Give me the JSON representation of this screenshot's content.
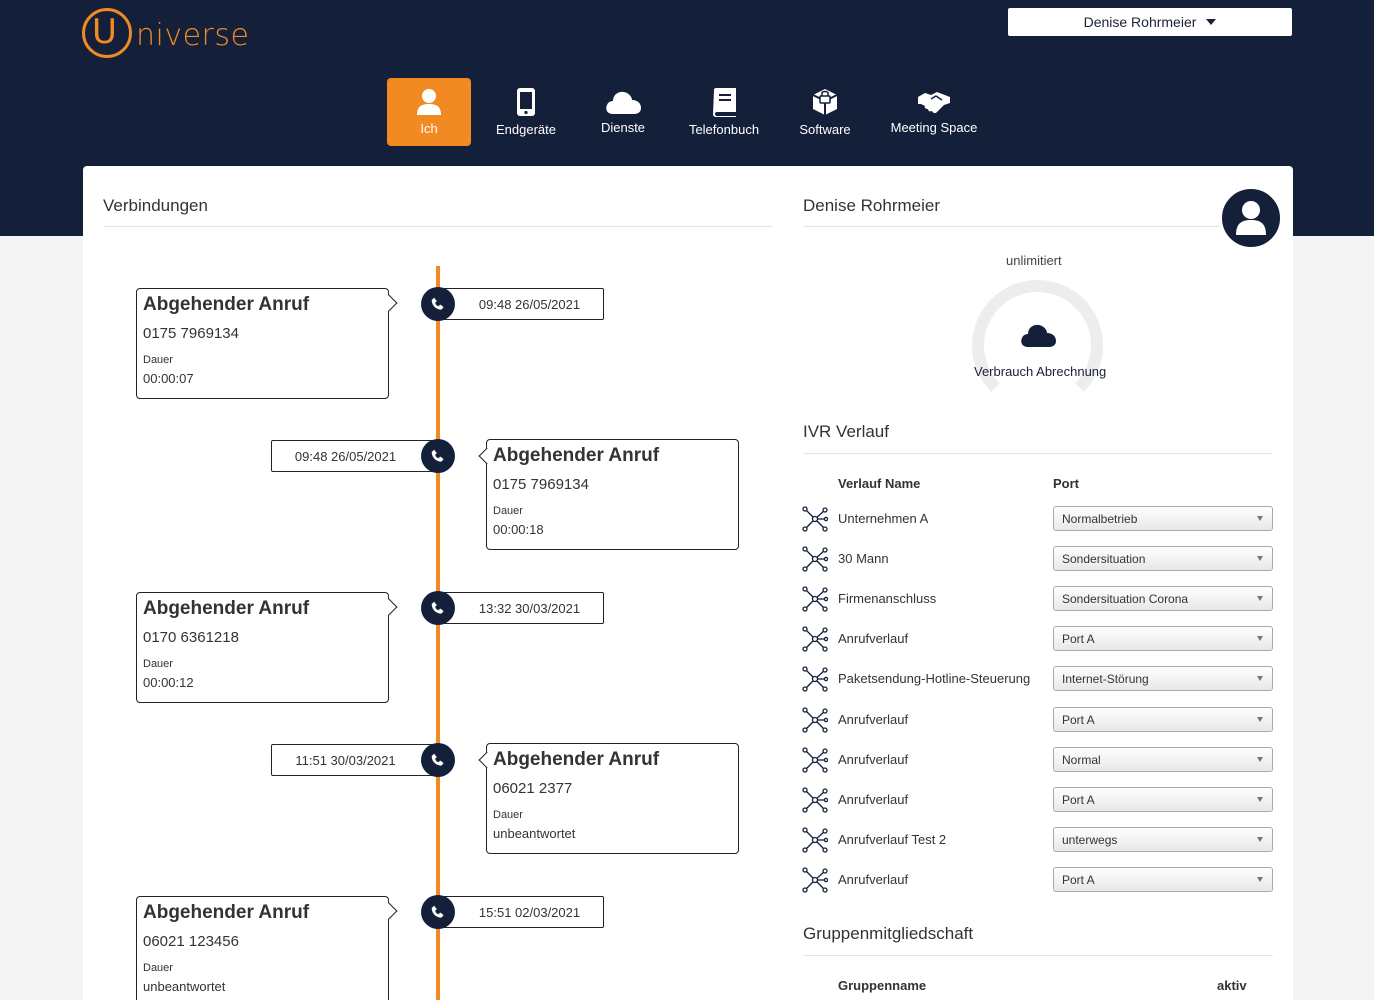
{
  "brand": {
    "logo_u": "U",
    "logo_rest": "niverse",
    "accent": "#f28a24",
    "navy": "#14203a"
  },
  "user_menu": {
    "name": "Denise Rohrmeier",
    "icon": "caret-down-icon"
  },
  "nav": [
    {
      "label": "Ich",
      "icon": "person-icon",
      "active": true
    },
    {
      "label": "Endgeräte",
      "icon": "smartphone-icon",
      "active": false
    },
    {
      "label": "Dienste",
      "icon": "cloud-icon",
      "active": false
    },
    {
      "label": "Telefonbuch",
      "icon": "book-icon",
      "active": false
    },
    {
      "label": "Software",
      "icon": "software-package-icon",
      "active": false
    },
    {
      "label": "Meeting Space",
      "icon": "handshake-icon",
      "active": false
    }
  ],
  "connections": {
    "title": "Verbindungen",
    "items": [
      {
        "type": "Abgehender Anruf",
        "number": "0175 7969134",
        "duration_label": "Dauer",
        "duration": "00:00:07",
        "datetime": "09:48 26/05/2021",
        "side": "left"
      },
      {
        "type": "Abgehender Anruf",
        "number": "0175 7969134",
        "duration_label": "Dauer",
        "duration": "00:00:18",
        "datetime": "09:48 26/05/2021",
        "side": "right"
      },
      {
        "type": "Abgehender Anruf",
        "number": "0170 6361218",
        "duration_label": "Dauer",
        "duration": "00:00:12",
        "datetime": "13:32 30/03/2021",
        "side": "left"
      },
      {
        "type": "Abgehender Anruf",
        "number": "06021 2377",
        "duration_label": "Dauer",
        "duration": "unbeantwortet",
        "datetime": "11:51 30/03/2021",
        "side": "right"
      },
      {
        "type": "Abgehender Anruf",
        "number": "06021 123456",
        "duration_label": "Dauer",
        "duration": "unbeantwortet",
        "datetime": "15:51 02/03/2021",
        "side": "left"
      }
    ]
  },
  "profile": {
    "name": "Denise Rohrmeier",
    "usage_top": "unlimitiert",
    "usage_label": "Verbrauch Abrechnung"
  },
  "ivr": {
    "title": "IVR Verlauf",
    "col_name": "Verlauf Name",
    "col_port": "Port",
    "rows": [
      {
        "name": "Unternehmen A",
        "port": "Normalbetrieb"
      },
      {
        "name": "30 Mann",
        "port": "Sondersituation"
      },
      {
        "name": "Firmenanschluss",
        "port": "Sondersituation Corona"
      },
      {
        "name": "Anrufverlauf",
        "port": "Port A"
      },
      {
        "name": "Paketsendung-Hotline-Steuerung",
        "port": "Internet-Störung"
      },
      {
        "name": "Anrufverlauf",
        "port": "Port A"
      },
      {
        "name": "Anrufverlauf",
        "port": "Normal"
      },
      {
        "name": "Anrufverlauf",
        "port": "Port A"
      },
      {
        "name": "Anrufverlauf Test 2",
        "port": "unterwegs"
      },
      {
        "name": "Anrufverlauf",
        "port": "Port A"
      }
    ]
  },
  "groups": {
    "title": "Gruppenmitgliedschaft",
    "col_name": "Gruppenname",
    "col_active": "aktiv"
  }
}
